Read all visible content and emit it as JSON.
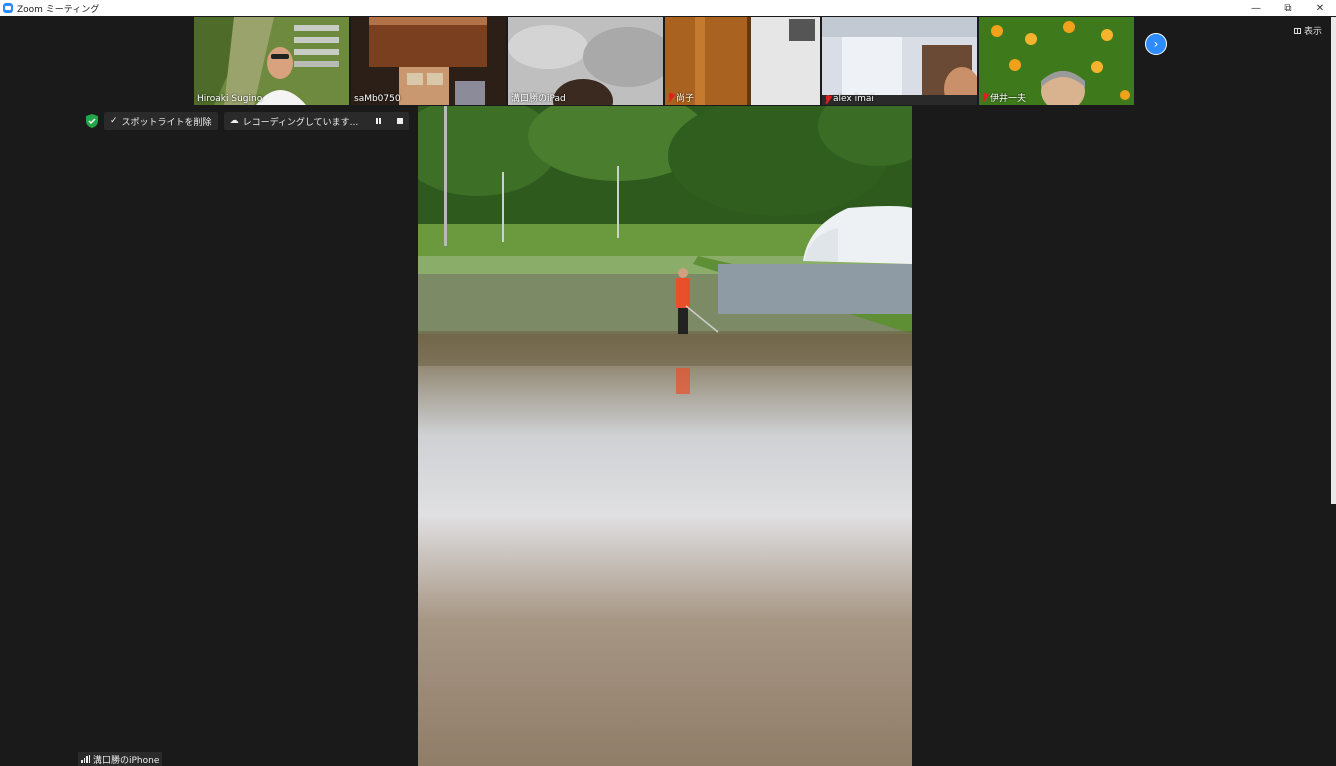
{
  "window": {
    "title": "Zoom ミーティング",
    "controls": [
      "minimize-icon",
      "restore-icon",
      "close-icon"
    ]
  },
  "participants": [
    {
      "name": "Hiroaki Sugino",
      "muted": false
    },
    {
      "name": "saMb0750",
      "muted": false
    },
    {
      "name": "溝口勝のiPad",
      "muted": false
    },
    {
      "name": "尚子",
      "muted": true
    },
    {
      "name": "alex imai",
      "muted": true
    },
    {
      "name": "伊井一夫",
      "muted": true
    }
  ],
  "view_button": {
    "label": "表示",
    "icon": "grid-icon"
  },
  "next_page_icon": "chevron-right-icon",
  "controls": {
    "security_icon": "shield-check-icon",
    "spotlight_label": "スポットライトを削除",
    "recording_label": "レコーディングしています...",
    "pause_icon": "pause-icon",
    "stop_icon": "stop-icon"
  },
  "self_view": {
    "label": "溝口勝のiPhone",
    "icon": "signal-icon"
  },
  "colors": {
    "accent": "#2d8cff",
    "background": "#1a1a1a",
    "muted_red": "#e02020",
    "shield_green": "#23a54a"
  }
}
